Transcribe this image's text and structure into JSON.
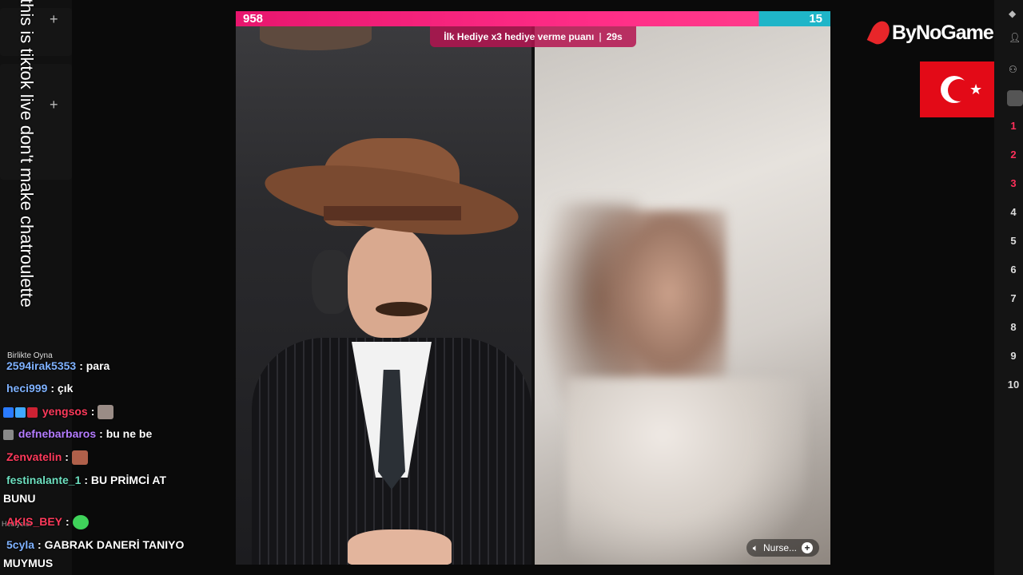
{
  "caption": "this is tiktok live don't make chatroulette",
  "sidebar": {
    "item_label": "Birlikte Oyna",
    "small_label": "Hediyeler"
  },
  "chat": {
    "messages": [
      {
        "user": "2594irak5353",
        "text": ": para",
        "color": "#7fb2ff"
      },
      {
        "user": "heci999",
        "text": ": çık",
        "color": "#7fb2ff"
      },
      {
        "user": "yengsos",
        "text": ":",
        "color": "#ff3b5c"
      },
      {
        "user": "defnebarbaros",
        "text": ": bu ne be",
        "color": "#b47cff"
      },
      {
        "user": "Zenvatelin",
        "text": ":",
        "color": "#ff3b5c"
      },
      {
        "user": "festinalante_1",
        "text": ": BU PRİMCİ AT",
        "color": "#6ee0c0"
      },
      {
        "user": "",
        "text": "BUNU",
        "color": "#ffffff"
      },
      {
        "user": "AKIS_BEY",
        "text": ":",
        "color": "#ff3b5c"
      },
      {
        "user": "5cyla",
        "text": ": GABRAK DANERİ TANIYO",
        "color": "#7fb2ff"
      },
      {
        "user": "",
        "text": "MUYMUS",
        "color": "#ffffff"
      }
    ]
  },
  "stream": {
    "score_left": "958",
    "score_right": "15",
    "gift_banner": "İlk Hediye x3 hediye verme puanı",
    "gift_timer": "29s",
    "guest_name": "Nurse..."
  },
  "brand": {
    "name": "ByNoGame"
  },
  "ranks": [
    "1",
    "2",
    "3",
    "4",
    "5",
    "6",
    "7",
    "8",
    "9",
    "10"
  ],
  "colors": {
    "accent_pink": "#ff2d87",
    "accent_teal": "#1fb5c8",
    "rank_top": "#ff2f5a",
    "flag_red": "#e30a17"
  }
}
